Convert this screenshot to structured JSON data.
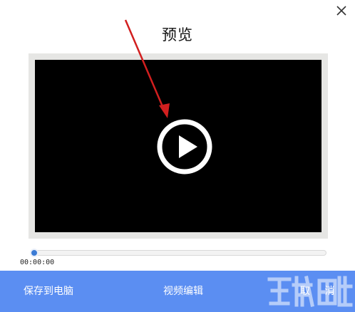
{
  "dialog": {
    "title": "预览",
    "close_icon": "close-icon"
  },
  "player": {
    "play_icon": "play-icon",
    "current_time": "00:00:00",
    "progress": 0
  },
  "actions": {
    "save_to_pc": "保存到电脑",
    "video_edit": "视频编辑",
    "cancel": "取 消"
  },
  "annotation": {
    "arrow_color": "#d21f1f"
  },
  "colors": {
    "action_bar": "#5b8ef2",
    "seek_thumb": "#3a7bd5",
    "video_bg": "#000000",
    "frame_bg": "#e6e6e4"
  }
}
